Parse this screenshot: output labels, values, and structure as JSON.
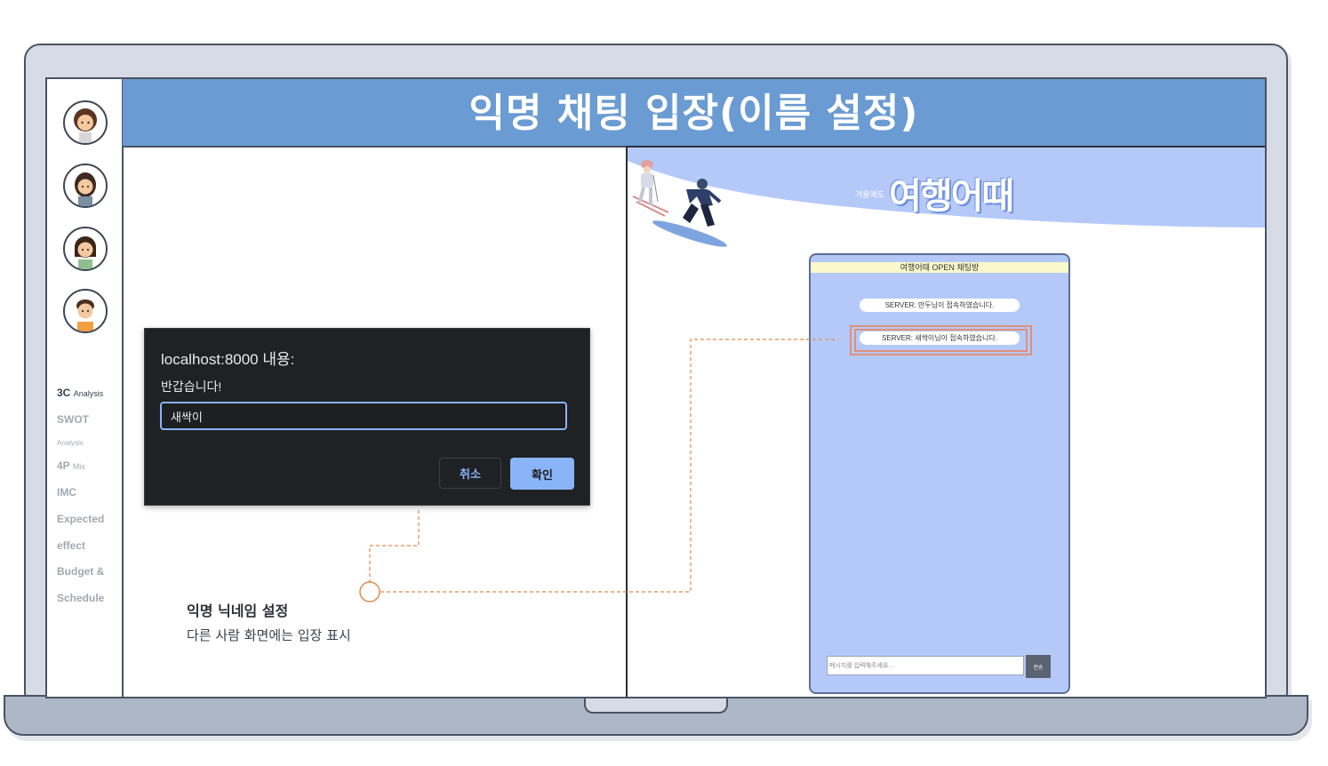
{
  "header": {
    "title": "익명 채팅 입장(이름 설정)"
  },
  "sidebar": {
    "items": [
      {
        "label": "3C",
        "sub": "Analysis"
      },
      {
        "label": "SWOT",
        "sub": "Analysis"
      },
      {
        "label": "4P",
        "sub": "Mix"
      },
      {
        "label": "IMC",
        "sub": ""
      },
      {
        "label": "Expected",
        "sub": ""
      },
      {
        "label": "effect",
        "sub": ""
      },
      {
        "label": "Budget &",
        "sub": ""
      },
      {
        "label": "Schedule",
        "sub": ""
      }
    ]
  },
  "dialog": {
    "title": "localhost:8000 내용:",
    "message": "반갑습니다!",
    "input_value": "새싹이",
    "cancel_label": "취소",
    "ok_label": "확인"
  },
  "annotation": {
    "title": "익명 닉네임 설정",
    "description": "다른 사람 화면에는 입장 표시"
  },
  "chat": {
    "brand_small": "겨울에도",
    "brand_title": "여행어때",
    "header": "여행어때 OPEN 채팅방",
    "messages": [
      "SERVER: 만두님이 접속하였습니다.",
      "SERVER: 새싹이님이 접속하였습니다."
    ],
    "input_placeholder": "메시지를 입력해주세요...",
    "send_label": "전송"
  },
  "colors": {
    "header_blue": "#6a9bd2",
    "chat_bg": "#b5c9f9",
    "dialog_bg": "#202124",
    "dialog_accent": "#8ab4f8",
    "annotation_line": "#e08a4a"
  }
}
